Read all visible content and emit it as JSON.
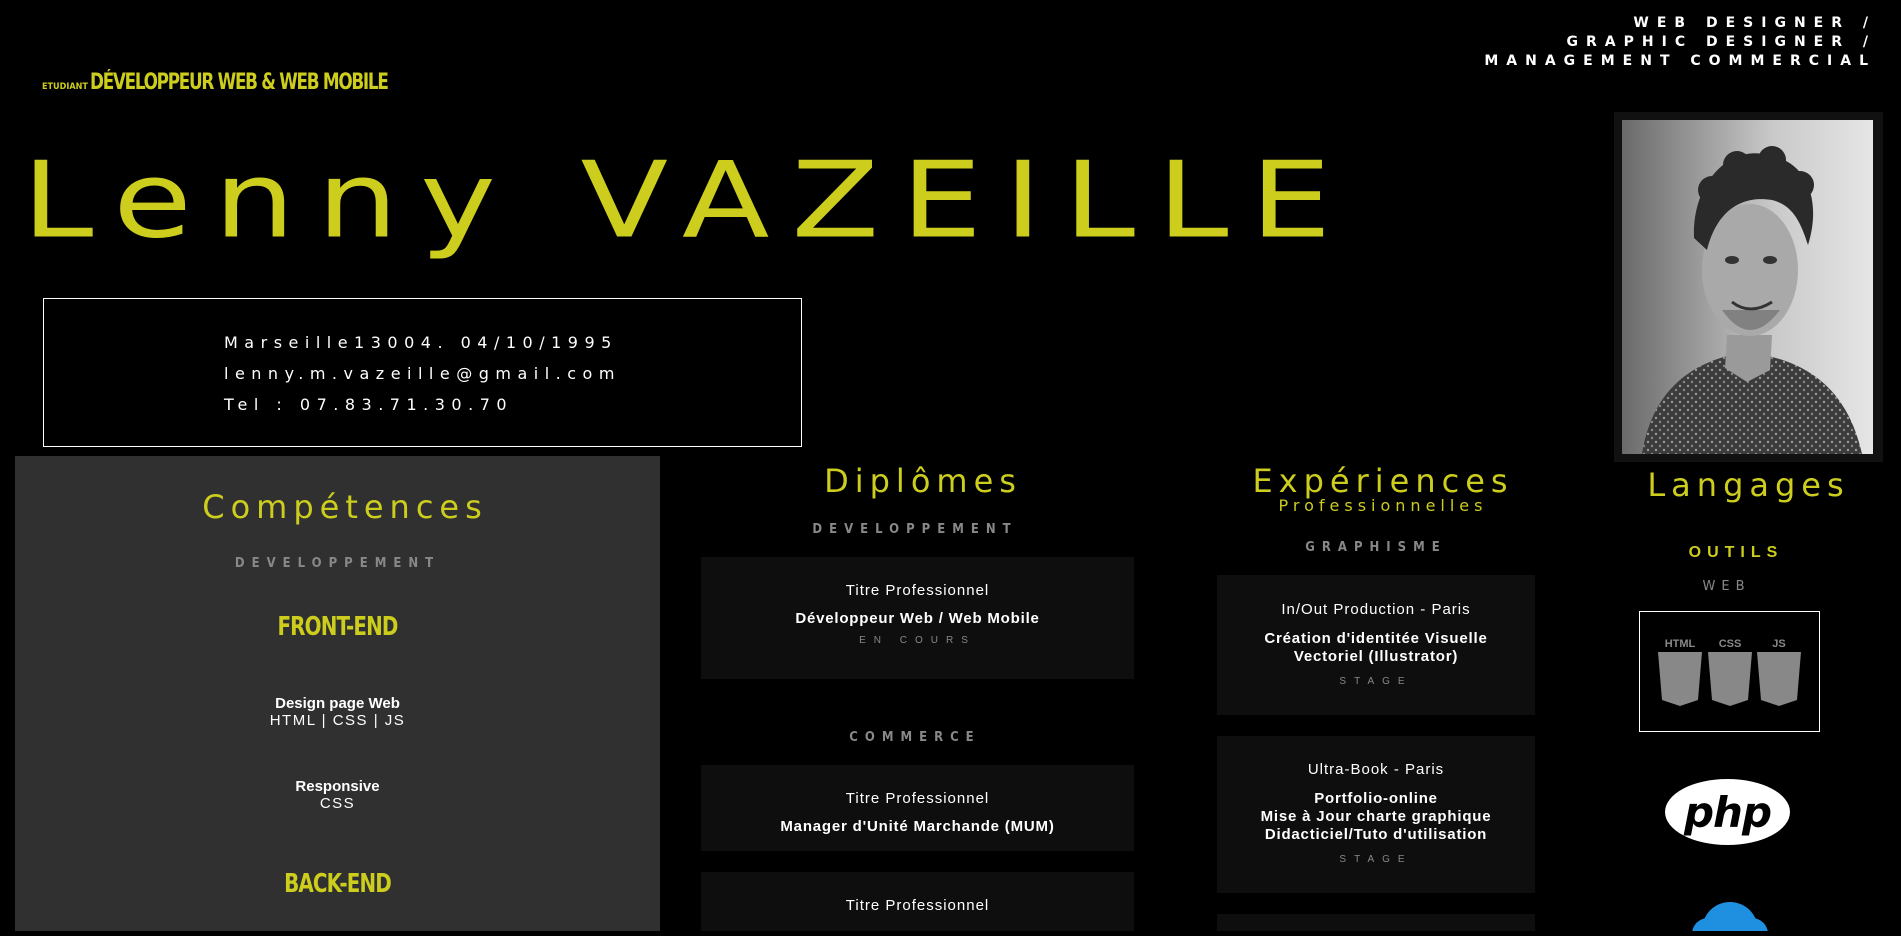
{
  "header": {
    "roles": [
      "WEB DESIGNER /",
      "GRAPHIC DESIGNER /",
      "MANAGEMENT COMMERCIAL"
    ],
    "subtitle_small": "ETUDIANT",
    "subtitle_big": "DÉVELOPPEUR WEB & WEB MOBILE",
    "name": "Lenny VAZEILLE"
  },
  "contact": {
    "address": "Marseille13004. 04/10/1995",
    "email": "lenny.m.vazeille@gmail.com",
    "phone": "Tel : 07.83.71.30.70"
  },
  "competences": {
    "title": "Compétences",
    "category": "DEVELOPPEMENT",
    "front_end_label": "FRONT-END",
    "items": [
      {
        "title": "Design page Web",
        "detail": "HTML | CSS | JS"
      },
      {
        "title": "Responsive",
        "detail": "CSS"
      }
    ],
    "back_end_label": "BACK-END"
  },
  "diplomes": {
    "title": "Diplômes",
    "category_dev": "DEVELOPPEMENT",
    "card1": {
      "org": "Titre Professionnel",
      "title": "Développeur Web / Web Mobile",
      "tag": "EN COURS"
    },
    "category_commerce": "COMMERCE",
    "card2": {
      "org": "Titre Professionnel",
      "title": "Manager d'Unité Marchande (MUM)"
    },
    "card3": {
      "org": "Titre Professionnel"
    }
  },
  "experiences": {
    "title": "Expériences",
    "subtitle": "Professionnelles",
    "category": "GRAPHISME",
    "card1": {
      "org": "In/Out Production - Paris",
      "title_l1": "Création d'identitée Visuelle",
      "title_l2": "Vectoriel (Illustrator)",
      "tag": "STAGE"
    },
    "card2": {
      "org": "Ultra-Book - Paris",
      "title_l1": "Portfolio-online",
      "title_l2": "Mise à Jour charte graphique",
      "title_l3": "Didacticiel/Tuto d'utilisation",
      "tag": "STAGE"
    }
  },
  "langages": {
    "title": "Langages",
    "tools_label": "OUTILS",
    "web_label": "WEB",
    "badges": [
      "HTML",
      "CSS",
      "JS"
    ],
    "php_logo": "php"
  },
  "colors": {
    "accent": "#cdcd1e",
    "panel": "#303030",
    "card": "#0e0e0e"
  }
}
